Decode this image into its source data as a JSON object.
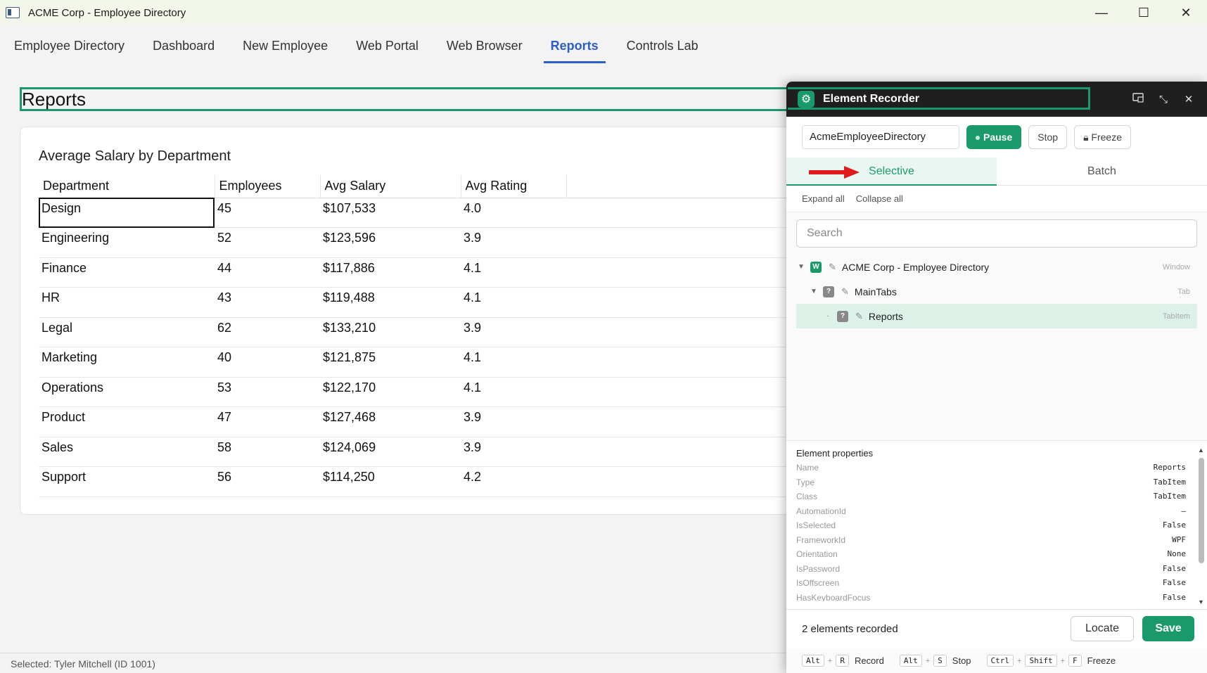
{
  "window": {
    "title": "ACME Corp - Employee Directory",
    "controls": {
      "minimize": "—",
      "maximize": "☐",
      "close": "✕"
    }
  },
  "tabs": [
    {
      "label": "Employee Directory"
    },
    {
      "label": "Dashboard"
    },
    {
      "label": "New Employee"
    },
    {
      "label": "Web Portal"
    },
    {
      "label": "Web Browser"
    },
    {
      "label": "Reports",
      "active": true
    },
    {
      "label": "Controls Lab"
    }
  ],
  "page": {
    "title": "Reports",
    "report_title": "Average Salary by Department",
    "columns": [
      "Department",
      "Employees",
      "Avg Salary",
      "Avg Rating"
    ],
    "rows": [
      [
        "Design",
        "45",
        "$107,533",
        "4.0"
      ],
      [
        "Engineering",
        "52",
        "$123,596",
        "3.9"
      ],
      [
        "Finance",
        "44",
        "$117,886",
        "4.1"
      ],
      [
        "HR",
        "43",
        "$119,488",
        "4.1"
      ],
      [
        "Legal",
        "62",
        "$133,210",
        "3.9"
      ],
      [
        "Marketing",
        "40",
        "$121,875",
        "4.1"
      ],
      [
        "Operations",
        "53",
        "$122,170",
        "4.1"
      ],
      [
        "Product",
        "47",
        "$127,468",
        "3.9"
      ],
      [
        "Sales",
        "58",
        "$124,069",
        "3.9"
      ],
      [
        "Support",
        "56",
        "$114,250",
        "4.2"
      ]
    ]
  },
  "status": {
    "text": "Selected: Tyler Mitchell (ID 1001)"
  },
  "recorder": {
    "title": "Element Recorder",
    "app_name": "AcmeEmployeeDirectory",
    "pause_label": "Pause",
    "stop_label": "Stop",
    "freeze_label": "Freeze",
    "mode_tabs": [
      "Selective",
      "Batch"
    ],
    "expand_all": "Expand all",
    "collapse_all": "Collapse all",
    "search_placeholder": "Search",
    "tree": [
      {
        "label": "ACME Corp - Employee Directory",
        "type": "Window",
        "badge": "W"
      },
      {
        "label": "MainTabs",
        "type": "Tab",
        "badge": "?"
      },
      {
        "label": "Reports",
        "type": "TabItem",
        "badge": "?"
      }
    ],
    "properties_title": "Element properties",
    "properties": [
      {
        "name": "Name",
        "value": "Reports"
      },
      {
        "name": "Type",
        "value": "TabItem"
      },
      {
        "name": "Class",
        "value": "TabItem"
      },
      {
        "name": "AutomationId",
        "value": "—"
      },
      {
        "name": "IsSelected",
        "value": "False"
      },
      {
        "name": "FrameworkId",
        "value": "WPF"
      },
      {
        "name": "Orientation",
        "value": "None"
      },
      {
        "name": "IsPassword",
        "value": "False"
      },
      {
        "name": "IsOffscreen",
        "value": "False"
      },
      {
        "name": "HasKeyboardFocus",
        "value": "False"
      }
    ],
    "count_text": "2 elements recorded",
    "locate_label": "Locate",
    "save_label": "Save",
    "shortcuts": [
      {
        "keys": [
          "Alt",
          "R"
        ],
        "label": "Record"
      },
      {
        "keys": [
          "Alt",
          "S"
        ],
        "label": "Stop"
      },
      {
        "keys": [
          "Ctrl",
          "Shift",
          "F"
        ],
        "label": "Freeze"
      }
    ]
  },
  "colors": {
    "accent": "#1a9a6b",
    "tab_active": "#2b5fc7",
    "arrow": "#e01b1b"
  }
}
